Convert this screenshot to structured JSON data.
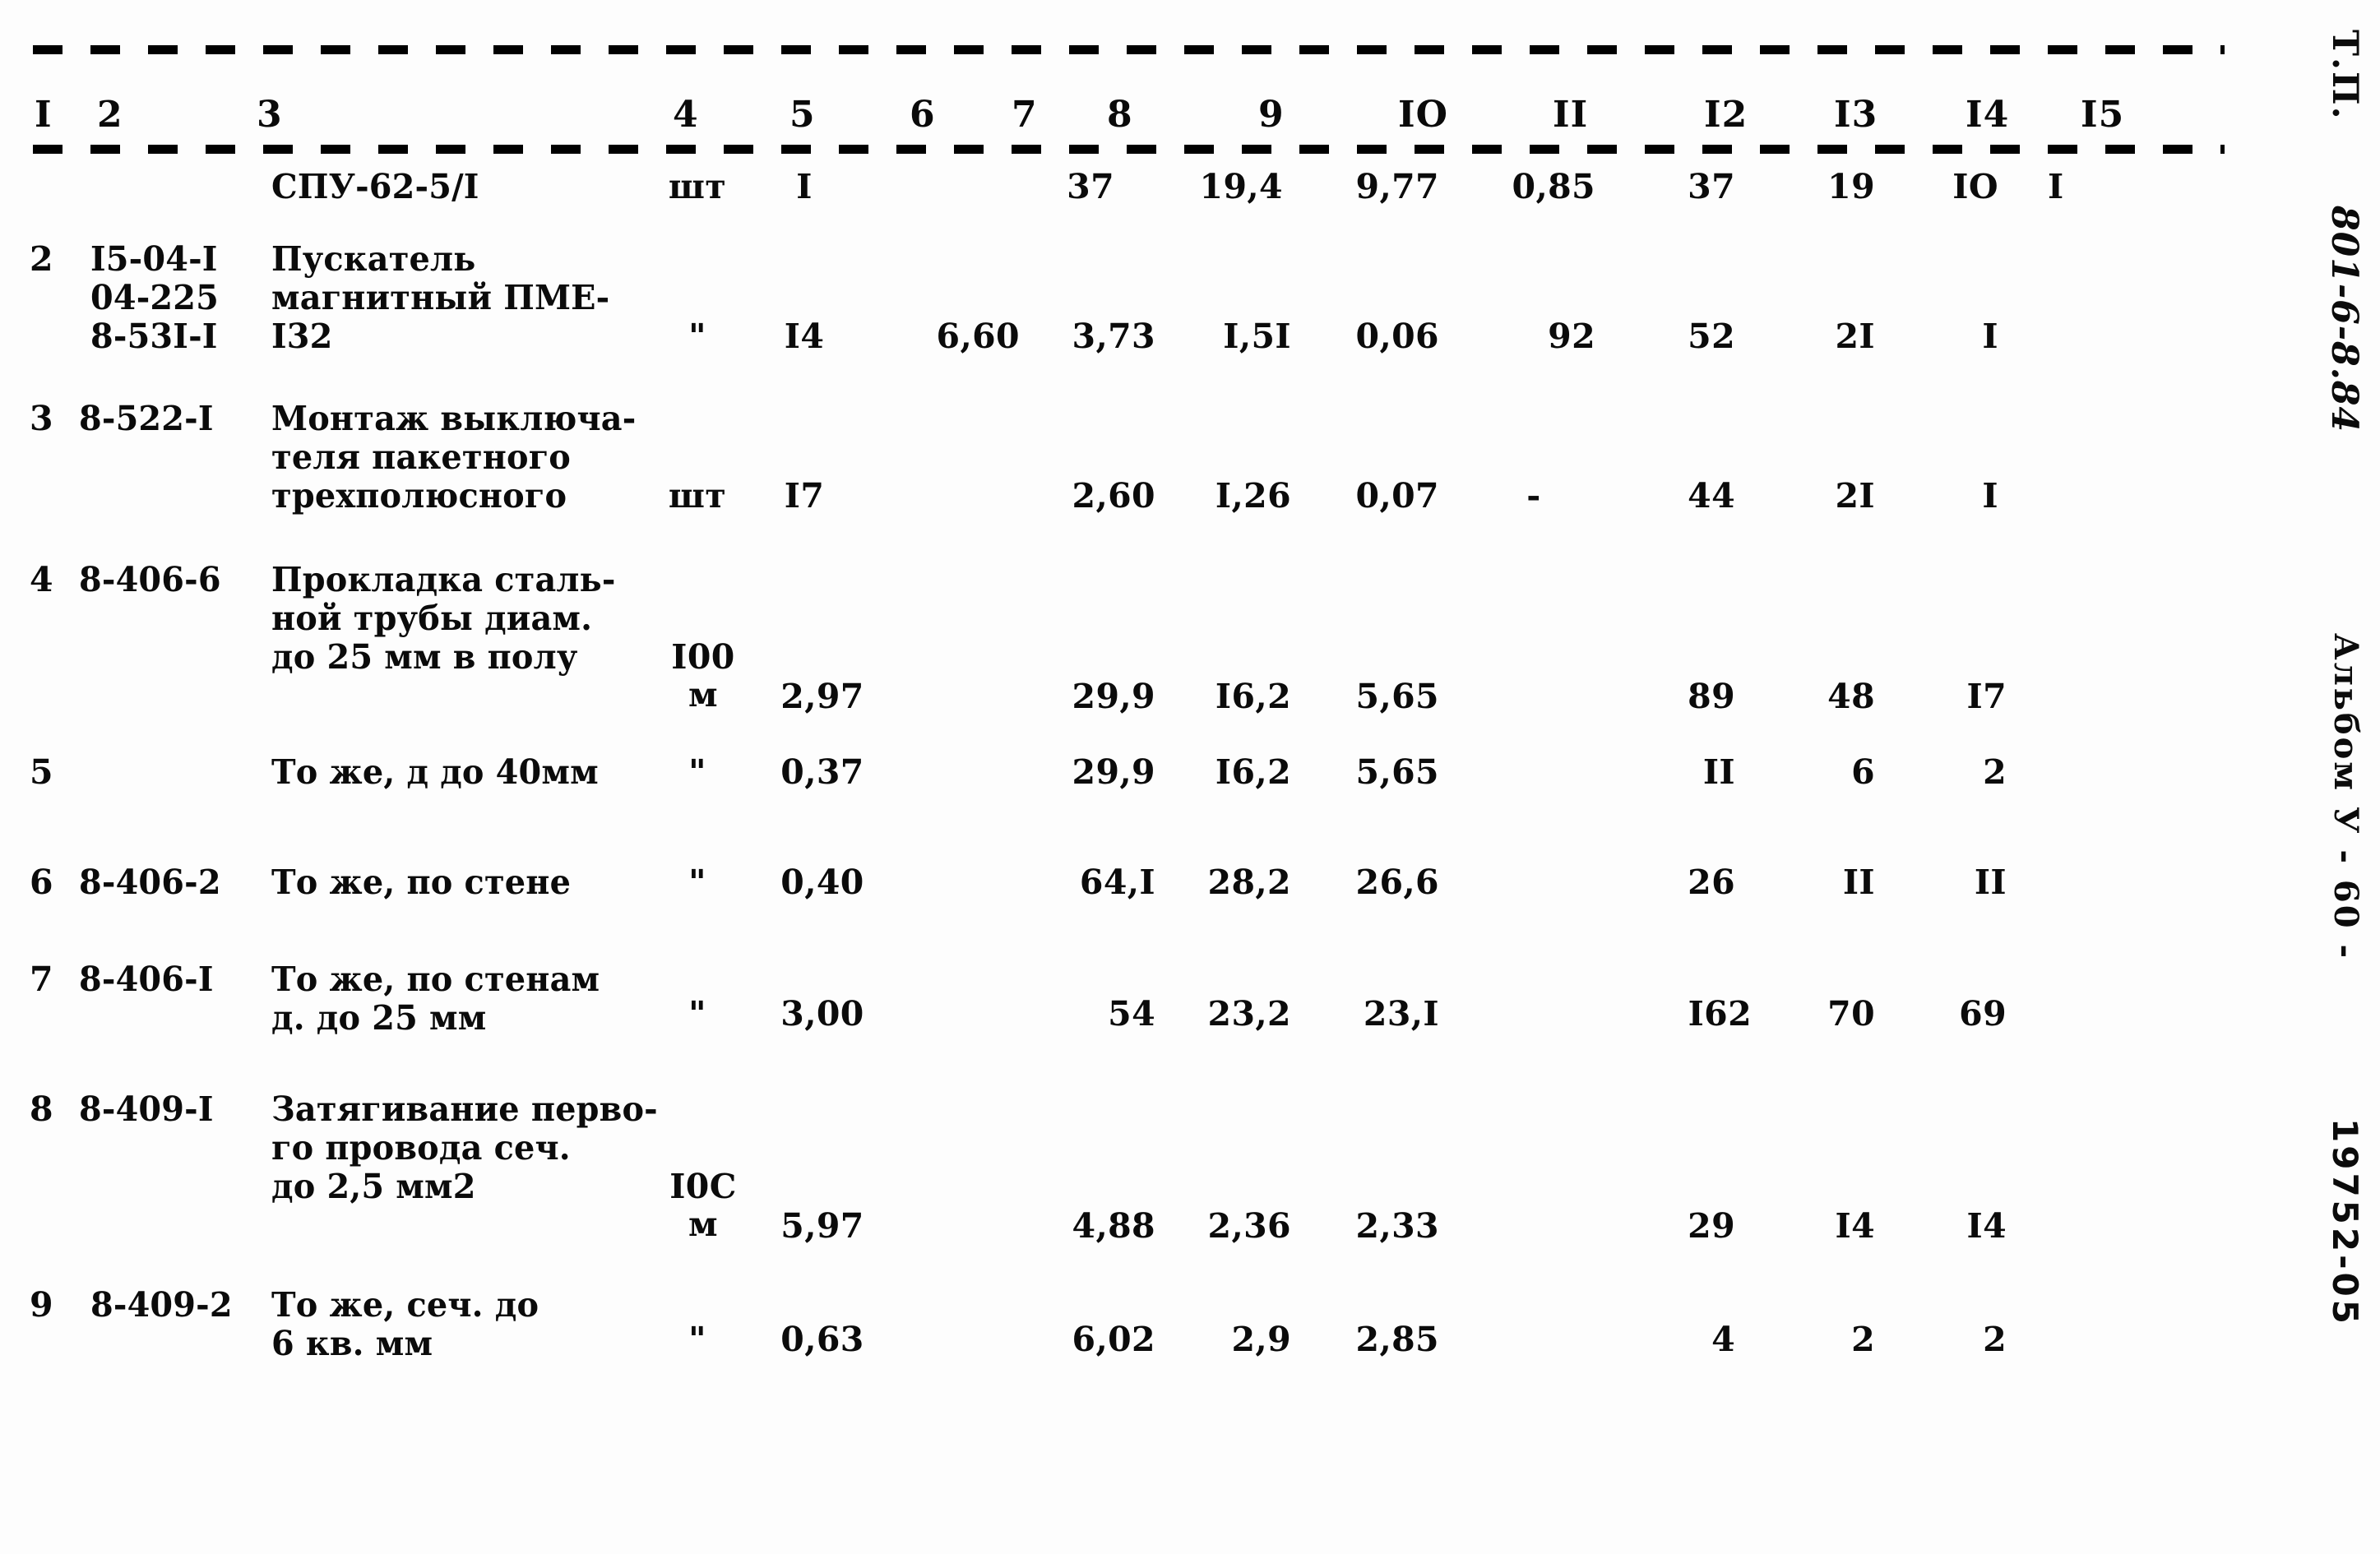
{
  "document": {
    "type": "estimate-table",
    "page_note_top": "Т.П.",
    "margin": {
      "tp_label": "Т.П.",
      "tp_handwritten": "801-6-8.84",
      "album_label": "Альбом У - 60 -",
      "archive_code": "19752-05"
    }
  },
  "table": {
    "column_headers": [
      "I",
      "2",
      "3",
      "4",
      "5",
      "6",
      "7",
      "8",
      "9",
      "IO",
      "II",
      "I2",
      "I3",
      "I4",
      "I5"
    ],
    "rows": [
      {
        "c1": "",
        "c2": "",
        "c3": [
          "СПУ-62-5/I"
        ],
        "c4": "шт",
        "c5": "I",
        "c6": "",
        "c7": "",
        "c8": "37",
        "c9": "19,4",
        "c10": "9,77",
        "c11": "0,85",
        "c12": "37",
        "c13": "19",
        "c14": "IO",
        "c15": "I"
      },
      {
        "c1": "2",
        "c2": [
          "I5-04-I",
          "04-225",
          "8-53I-I"
        ],
        "c3": [
          "Пускатель",
          "магнитный ПМЕ-",
          "I32"
        ],
        "c4": "\"",
        "c5": "I4",
        "c6": "",
        "c7": "6,60",
        "c8": "3,73",
        "c9": "I,5I",
        "c10": "0,06",
        "c11": "92",
        "c12": "52",
        "c13": "2I",
        "c14": "I",
        "c15": ""
      },
      {
        "c1": "3",
        "c2": [
          "8-522-I"
        ],
        "c3": [
          "Монтаж выключа-",
          "теля пакетного",
          "трехполюсного"
        ],
        "c4": "шт",
        "c5": "I7",
        "c6": "",
        "c7": "",
        "c8": "2,60",
        "c9": "I,26",
        "c10": "0,07",
        "c11": "-",
        "c12": "44",
        "c13": "2I",
        "c14": "I",
        "c15": ""
      },
      {
        "c1": "4",
        "c2": [
          "8-406-6"
        ],
        "c3": [
          "Прокладка сталь-",
          "ной трубы диам.",
          "до 25 мм в полу"
        ],
        "c4": "I00\nм",
        "c5": "2,97",
        "c6": "",
        "c7": "",
        "c8": "29,9",
        "c9": "I6,2",
        "c10": "5,65",
        "c11": "",
        "c12": "89",
        "c13": "48",
        "c14": "I7",
        "c15": ""
      },
      {
        "c1": "5",
        "c2": [
          ""
        ],
        "c3": [
          "То же, д до 40мм"
        ],
        "c4": "\"",
        "c5": "0,37",
        "c6": "",
        "c7": "",
        "c8": "29,9",
        "c9": "I6,2",
        "c10": "5,65",
        "c11": "",
        "c12": "II",
        "c13": "6",
        "c14": "2",
        "c15": ""
      },
      {
        "c1": "6",
        "c2": [
          "8-406-2"
        ],
        "c3": [
          "То же, по стене"
        ],
        "c4": "\"",
        "c5": "0,40",
        "c6": "",
        "c7": "",
        "c8": "64,I",
        "c9": "28,2",
        "c10": "26,6",
        "c11": "",
        "c12": "26",
        "c13": "II",
        "c14": "II",
        "c15": ""
      },
      {
        "c1": "7",
        "c2": [
          "8-406-I"
        ],
        "c3": [
          "То же, по стенам",
          "д. до 25 мм"
        ],
        "c4": "\"",
        "c5": "3,00",
        "c6": "",
        "c7": "",
        "c8": "54",
        "c9": "23,2",
        "c10": "23,I",
        "c11": "",
        "c12": "I62",
        "c13": "70",
        "c14": "69",
        "c15": ""
      },
      {
        "c1": "8",
        "c2": [
          "8-409-I"
        ],
        "c3": [
          "Затягивание перво-",
          "го провода сеч.",
          "до 2,5 мм2"
        ],
        "c4": "I0С\nм",
        "c5": "5,97",
        "c6": "",
        "c7": "",
        "c8": "4,88",
        "c9": "2,36",
        "c10": "2,33",
        "c11": "",
        "c12": "29",
        "c13": "I4",
        "c14": "I4",
        "c15": ""
      },
      {
        "c1": "9",
        "c2": [
          "8-409-2"
        ],
        "c3": [
          "То же, сеч. до",
          "6 кв. мм"
        ],
        "c4": "\"",
        "c5": "0,63",
        "c6": "",
        "c7": "",
        "c8": "6,02",
        "c9": "2,9",
        "c10": "2,85",
        "c11": "",
        "c12": "4",
        "c13": "2",
        "c14": "2",
        "c15": ""
      }
    ]
  }
}
